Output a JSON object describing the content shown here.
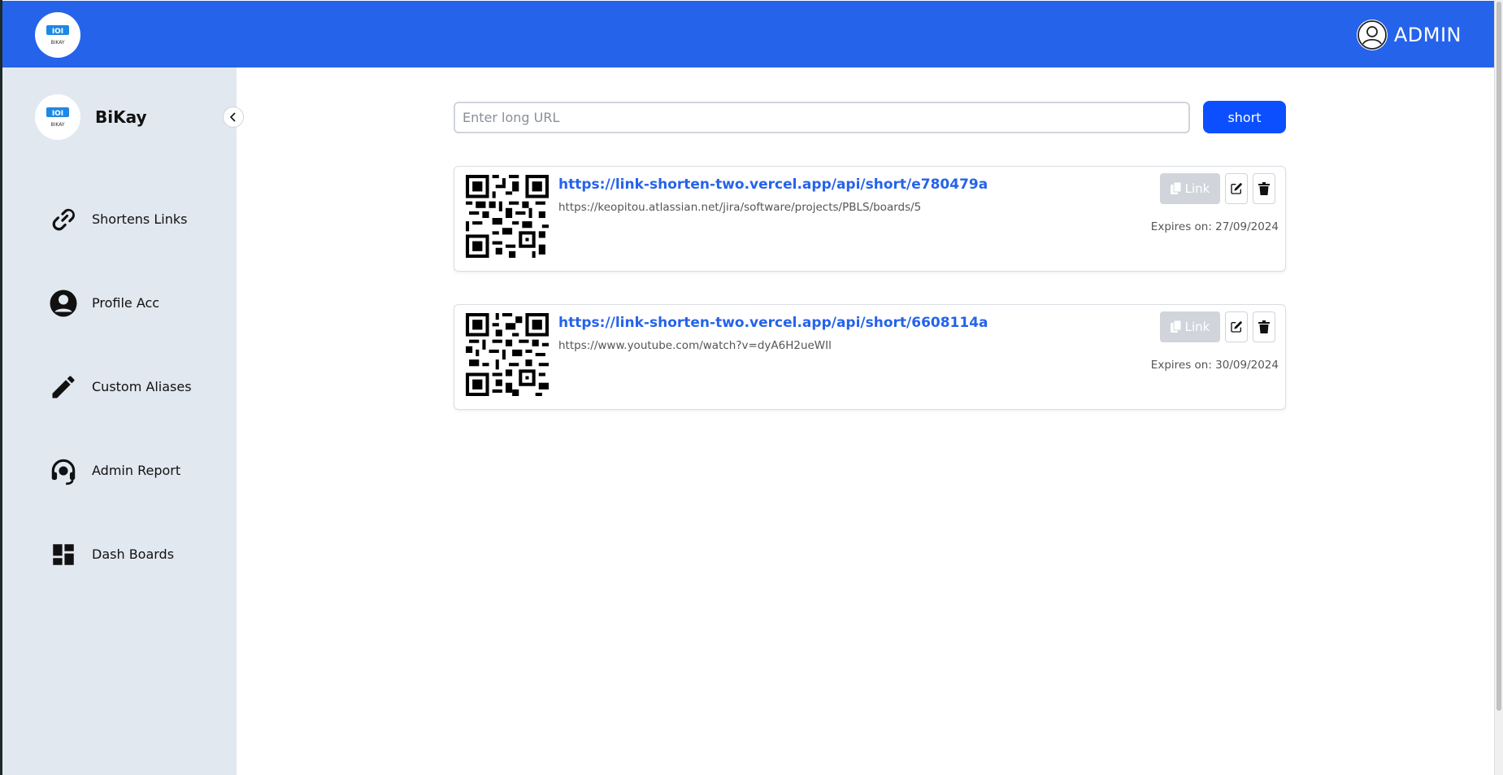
{
  "header": {
    "logo_icon": "bikay-logo",
    "user_icon": "user-circle-icon",
    "user_label": "ADMIN",
    "color": "#2563eb"
  },
  "sidebar": {
    "brand_name": "BiKay",
    "logo_text": "BIKAY",
    "collapse_icon": "chevron-left-icon",
    "items": [
      {
        "label": "Shortens Links",
        "icon": "link-icon"
      },
      {
        "label": "Profile Acc",
        "icon": "user-circle-filled-icon"
      },
      {
        "label": "Custom Aliases",
        "icon": "pencil-icon"
      },
      {
        "label": "Admin Report",
        "icon": "headset-icon"
      },
      {
        "label": "Dash Boards",
        "icon": "dashboard-icon"
      }
    ]
  },
  "shorten": {
    "placeholder": "Enter long URL",
    "button_label": "short"
  },
  "links": [
    {
      "short_url": "https://link-shorten-two.vercel.app/api/short/e780479a",
      "long_url": "https://keopitou.atlassian.net/jira/software/projects/PBLS/boards/5",
      "copy_label": "Link",
      "expires": "Expires on: 27/09/2024"
    },
    {
      "short_url": "https://link-shorten-two.vercel.app/api/short/6608114a",
      "long_url": "https://www.youtube.com/watch?v=dyA6H2ueWIl",
      "copy_label": "Link",
      "expires": "Expires on: 30/09/2024"
    }
  ]
}
